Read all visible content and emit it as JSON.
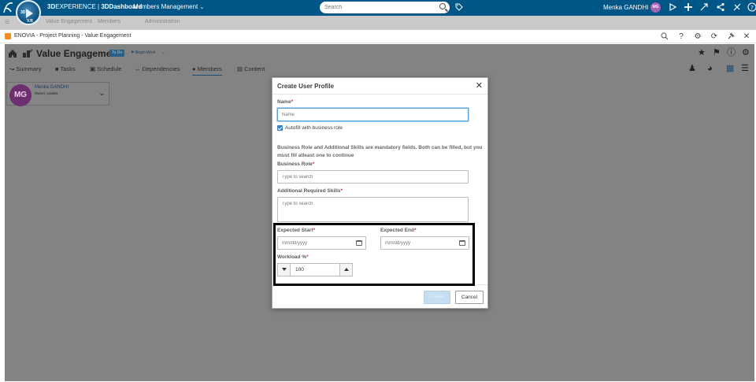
{
  "topbar": {
    "brand_bold": "3D",
    "brand_rest": "EXPERIENCE | ",
    "dashboard": "3DDashboard",
    "app_name": "Members Management",
    "compass_labels": [
      "3D",
      "V.R"
    ],
    "search_placeholder": "Search",
    "user_name": "Menka GANDHI",
    "user_initials": "MG",
    "icons": [
      "ds-logo-icon",
      "tag-icon",
      "share-icon",
      "add-icon",
      "collaborate-icon",
      "network-icon",
      "tools-icon",
      "help-icon"
    ]
  },
  "subbar": {
    "items": [
      "☰",
      "Value Engagement",
      "Members",
      "Administration"
    ]
  },
  "window": {
    "title": "ENOVIA - Project Planning - Value Engagement",
    "icons": [
      "search-icon",
      "help-icon",
      "settings-icon",
      "refresh-icon",
      "pin-icon",
      "close-icon"
    ]
  },
  "app": {
    "project_title": "Value Engagement",
    "status_badge": "To Do",
    "begin_work": "Begin Work",
    "tabs": [
      "Summary",
      "Tasks",
      "Schedule",
      "Dependencies",
      "Members",
      "Content"
    ],
    "active_tab": "Members",
    "member": {
      "initials": "MG",
      "name": "Menka GANDHI",
      "role": "Owner, Leader"
    }
  },
  "modal": {
    "title": "Create User Profile",
    "name_label": "Name",
    "name_placeholder": "Name",
    "autofill_label": "Autofill with business role",
    "autofill_checked": true,
    "note": "Business Role and Additional Skills are mandatory fields. Both can be filled, but you must fill atleast one to continue",
    "business_role_label": "Business Role",
    "business_role_placeholder": "Type to search",
    "skills_label": "Additional Required Skills",
    "skills_placeholder": "Type to search",
    "expected_start_label": "Expected Start",
    "expected_start_placeholder": "mm/dd/yyyy",
    "expected_end_label": "Expected End",
    "expected_end_placeholder": "mm/dd/yyyy",
    "workload_label": "Workload %",
    "workload_value": "100",
    "required_mark": "*",
    "create_label": "Create",
    "cancel_label": "Cancel"
  },
  "colors": {
    "topbar": "#005686",
    "accent": "#3d7fc1",
    "required": "#d0312d",
    "overlay": "#838383"
  }
}
